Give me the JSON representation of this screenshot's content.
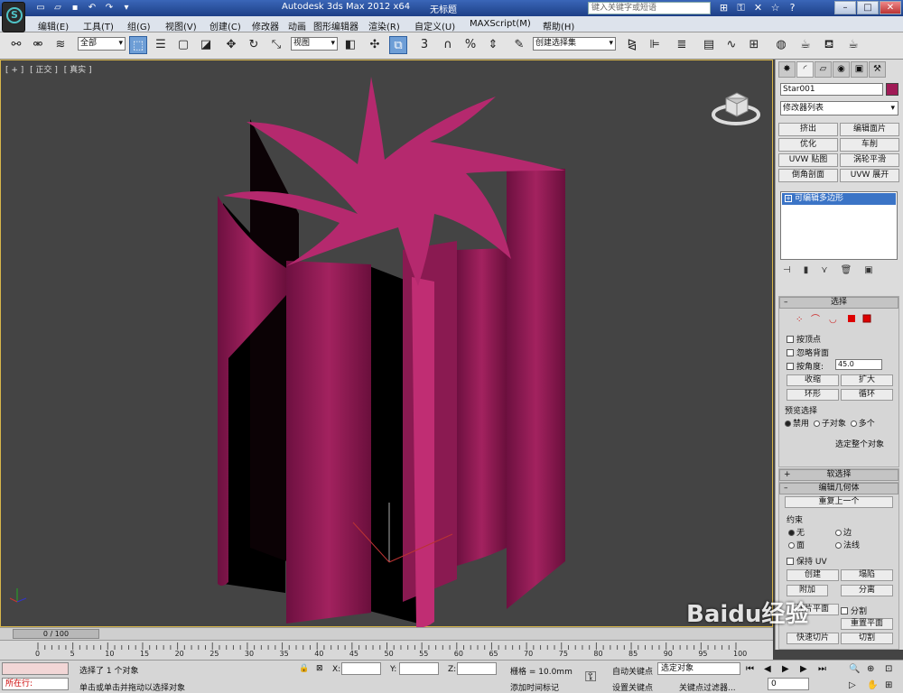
{
  "titlebar": {
    "title": "Autodesk 3ds Max  2012 x64",
    "document": "无标题",
    "search_placeholder": "键入关键字或短语",
    "logo": "S"
  },
  "quick_access": [
    "new-icon",
    "open-icon",
    "save-icon",
    "undo-icon",
    "redo-icon",
    "dropdown-icon"
  ],
  "menu": [
    "编辑(E)",
    "工具(T)",
    "组(G)",
    "视图(V)",
    "创建(C)",
    "修改器",
    "动画",
    "图形编辑器",
    "渲染(R)",
    "自定义(U)",
    "MAXScript(M)",
    "帮助(H)"
  ],
  "toolbar": {
    "selection_filter": "全部",
    "ref_coord": "视图",
    "named_sel": "创建选择集",
    "snap_label": "3",
    "angle_label": "%"
  },
  "viewport": {
    "label_plus": "[ + ]",
    "label_view": "[ 正交 ]",
    "label_shade": "[ 真实 ]",
    "object_color": "#b5296e"
  },
  "command_panel": {
    "tabs": [
      "✸",
      "◜",
      "▱",
      "◉",
      "▣",
      "⚒"
    ],
    "object_name": "Star001",
    "object_color": "#a01a56",
    "modifier_list": "修改器列表",
    "modifier_buttons": [
      "挤出",
      "编辑面片",
      "优化",
      "车削",
      "UVW 贴图",
      "涡轮平滑",
      "倒角剖面",
      "UVW 展开"
    ],
    "stack_item": "可编辑多边形",
    "selection": {
      "title": "选择",
      "by_vertex": "按顶点",
      "ignore_back": "忽略背面",
      "by_angle": "按角度:",
      "angle_value": "45.0",
      "shrink": "收缩",
      "grow": "扩大",
      "ring": "环形",
      "loop": "循环",
      "preview_title": "预览选择",
      "preview_off": "禁用",
      "preview_sub": "子对象",
      "preview_multi": "多个",
      "whole": "选定整个对象"
    },
    "soft_selection": "软选择",
    "edit_geometry": {
      "title": "编辑几何体",
      "repeat": "重复上一个",
      "constraints": "约束",
      "none": "无",
      "edge": "边",
      "face": "面",
      "normal": "法线",
      "preserve_uv": "保持 UV",
      "create": "创建",
      "collapse": "塌陷",
      "attach": "附加",
      "detach": "分离",
      "slice_plane": "切片平面",
      "split": "分割",
      "quick_slice": "快速切片",
      "cut": "切割",
      "reset_plane": "重置平面"
    }
  },
  "timeline": {
    "frame": "0 / 100",
    "ticks": [
      "0",
      "5",
      "10",
      "15",
      "20",
      "25",
      "30",
      "35",
      "40",
      "45",
      "50",
      "55",
      "60",
      "65",
      "70",
      "75",
      "80",
      "85",
      "90",
      "95",
      "100"
    ]
  },
  "status": {
    "maxscript": "所在行:",
    "selected": "选择了 1 个对象",
    "prompt": "单击或单击并拖动以选择对象",
    "x_label": "X:",
    "y_label": "Y:",
    "z_label": "Z:",
    "grid": "栅格 = 10.0mm",
    "add_time_tag": "添加时间标记",
    "auto_key": "自动关键点",
    "set_key": "设置关键点",
    "key_mode": "选定对象",
    "key_filters": "关键点过滤器...",
    "frame_value": "0"
  },
  "watermark": "Baidu经验"
}
